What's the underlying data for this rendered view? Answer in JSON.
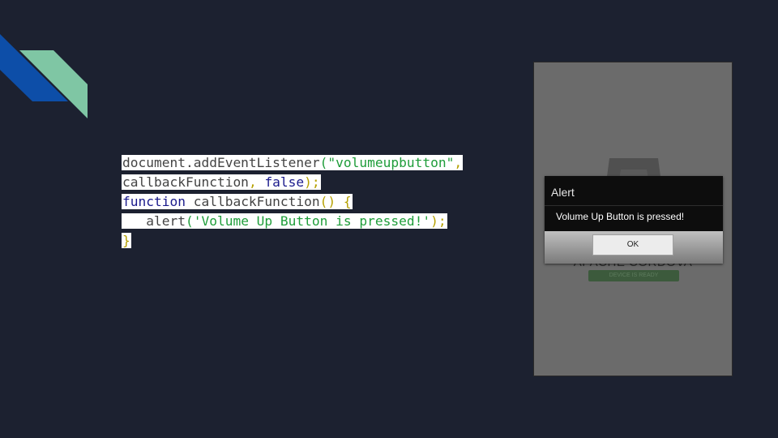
{
  "code": {
    "lines": [
      [
        {
          "text": "document.addEventListener",
          "cls": "c-default"
        },
        {
          "text": "(",
          "cls": "c-paren"
        },
        {
          "text": "\"volumeupbutton\"",
          "cls": "c-string"
        },
        {
          "text": ",",
          "cls": "c-punct"
        }
      ],
      [
        {
          "text": "callbackFunction",
          "cls": "c-default"
        },
        {
          "text": ", ",
          "cls": "c-punct"
        },
        {
          "text": "false",
          "cls": "c-keyword"
        },
        {
          "text": ");",
          "cls": "c-punct"
        }
      ],
      [
        {
          "text": "function",
          "cls": "c-keyword"
        },
        {
          "text": " callbackFunction",
          "cls": "c-default"
        },
        {
          "text": "() {",
          "cls": "c-punct"
        }
      ],
      [
        {
          "text": "   alert",
          "cls": "c-default"
        },
        {
          "text": "(",
          "cls": "c-paren"
        },
        {
          "text": "'Volume Up Button is pressed!'",
          "cls": "c-string"
        },
        {
          "text": ");",
          "cls": "c-punct"
        }
      ],
      [
        {
          "text": "}",
          "cls": "c-punct"
        }
      ]
    ]
  },
  "phone": {
    "app_title": "APACHE CORDOVA",
    "device_badge": "DEVICE IS READY",
    "dialog": {
      "title": "Alert",
      "message": "Volume Up Button is pressed!",
      "ok_label": "OK"
    }
  },
  "colors": {
    "background": "#1c2130",
    "accent_blue": "#0d4ea8",
    "accent_green": "#7fc6a4"
  }
}
